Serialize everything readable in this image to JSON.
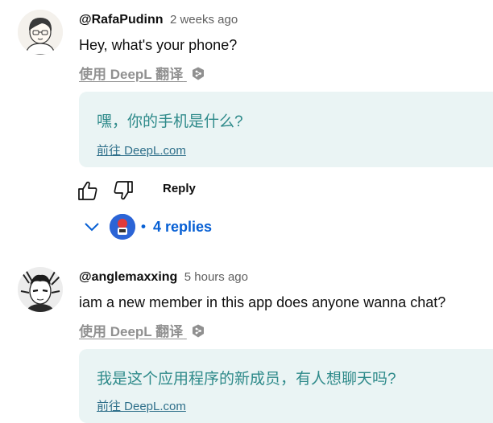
{
  "comments": [
    {
      "author": "@RafaPudinn",
      "time": "2 weeks ago",
      "text": "Hey, what's your phone?",
      "translate_link": "使用 DeepL 翻译",
      "translation": "嘿，你的手机是什么?",
      "goto_link": "前往 DeepL.com",
      "reply_label": "Reply",
      "replies_label": "4 replies",
      "replies_dot": "•"
    },
    {
      "author": "@anglemaxxing",
      "time": "5 hours ago",
      "text": "iam a new member in this app does anyone wanna chat?",
      "translate_link": "使用 DeepL 翻译",
      "translation": "我是这个应用程序的新成员，有人想聊天吗?",
      "goto_link": "前往 DeepL.com"
    }
  ],
  "colors": {
    "link_blue": "#065fd4",
    "translation_bg": "#eaf4f4",
    "translation_text": "#2e8a8a",
    "muted": "#909090"
  },
  "icons": [
    "cartoon-avatar-icon",
    "manga-avatar-icon",
    "deepl-icon",
    "thumbs-up-icon",
    "thumbs-down-icon",
    "chevron-down-icon",
    "reply-avatar-icon"
  ]
}
